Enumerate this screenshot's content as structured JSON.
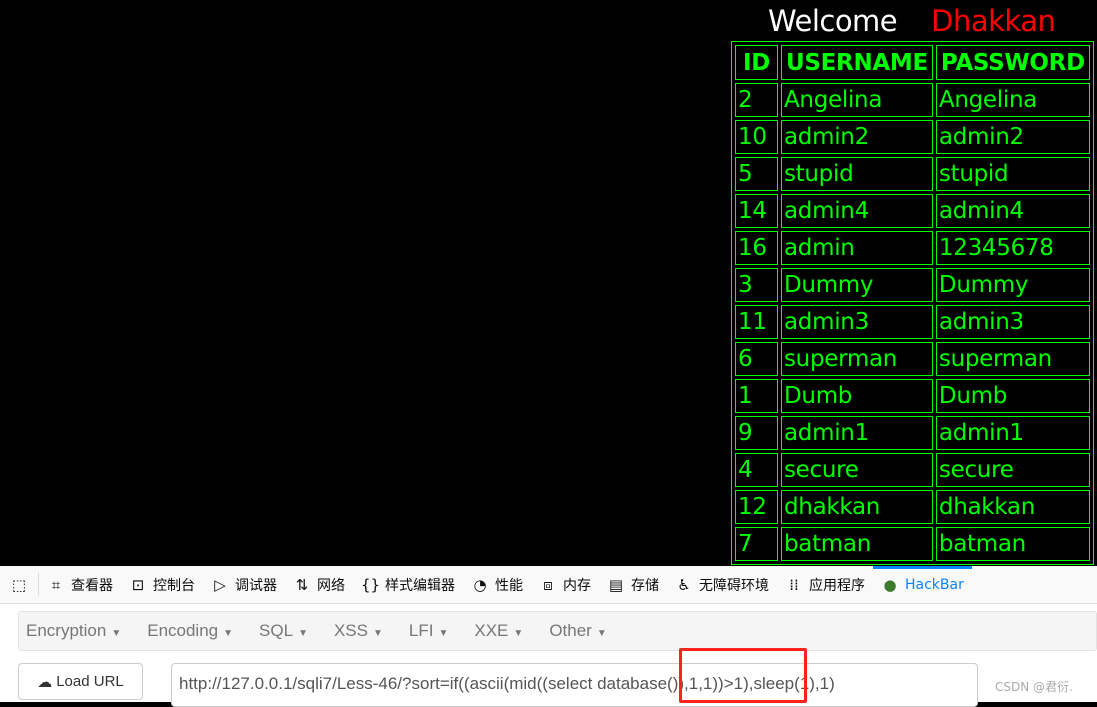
{
  "welcome": {
    "label": "Welcome",
    "name": "Dhakkan"
  },
  "table": {
    "headers": [
      "ID",
      "USERNAME",
      "PASSWORD"
    ],
    "rows": [
      [
        "2",
        "Angelina",
        "Angelina"
      ],
      [
        "10",
        "admin2",
        "admin2"
      ],
      [
        "5",
        "stupid",
        "stupid"
      ],
      [
        "14",
        "admin4",
        "admin4"
      ],
      [
        "16",
        "admin",
        "12345678"
      ],
      [
        "3",
        "Dummy",
        "Dummy"
      ],
      [
        "11",
        "admin3",
        "admin3"
      ],
      [
        "6",
        "superman",
        "superman"
      ],
      [
        "1",
        "Dumb",
        "Dumb"
      ],
      [
        "9",
        "admin1",
        "admin1"
      ],
      [
        "4",
        "secure",
        "secure"
      ],
      [
        "12",
        "dhakkan",
        "dhakkan"
      ],
      [
        "7",
        "batman",
        "batman"
      ]
    ]
  },
  "devtools": {
    "tabs": [
      {
        "icon": "inspector-icon",
        "label": "查看器"
      },
      {
        "icon": "console-icon",
        "label": "控制台"
      },
      {
        "icon": "debugger-icon",
        "label": "调试器"
      },
      {
        "icon": "network-icon",
        "label": "网络"
      },
      {
        "icon": "style-editor-icon",
        "label": "样式编辑器"
      },
      {
        "icon": "performance-icon",
        "label": "性能"
      },
      {
        "icon": "memory-icon",
        "label": "内存"
      },
      {
        "icon": "storage-icon",
        "label": "存储"
      },
      {
        "icon": "accessibility-icon",
        "label": "无障碍环境"
      },
      {
        "icon": "application-icon",
        "label": "应用程序"
      },
      {
        "icon": "hackbar-icon",
        "label": "HackBar",
        "active": true
      }
    ]
  },
  "hackbar": {
    "menu": [
      "Encryption",
      "Encoding",
      "SQL",
      "XSS",
      "LFI",
      "XXE",
      "Other"
    ],
    "load_url": "Load URL",
    "url": "http://127.0.0.1/sqli7/Less-46/?sort=if((ascii(mid((select database()),1,1))>1),sleep(1),1)"
  },
  "highlight_color": "#ff2020",
  "watermark": "CSDN @君衍."
}
